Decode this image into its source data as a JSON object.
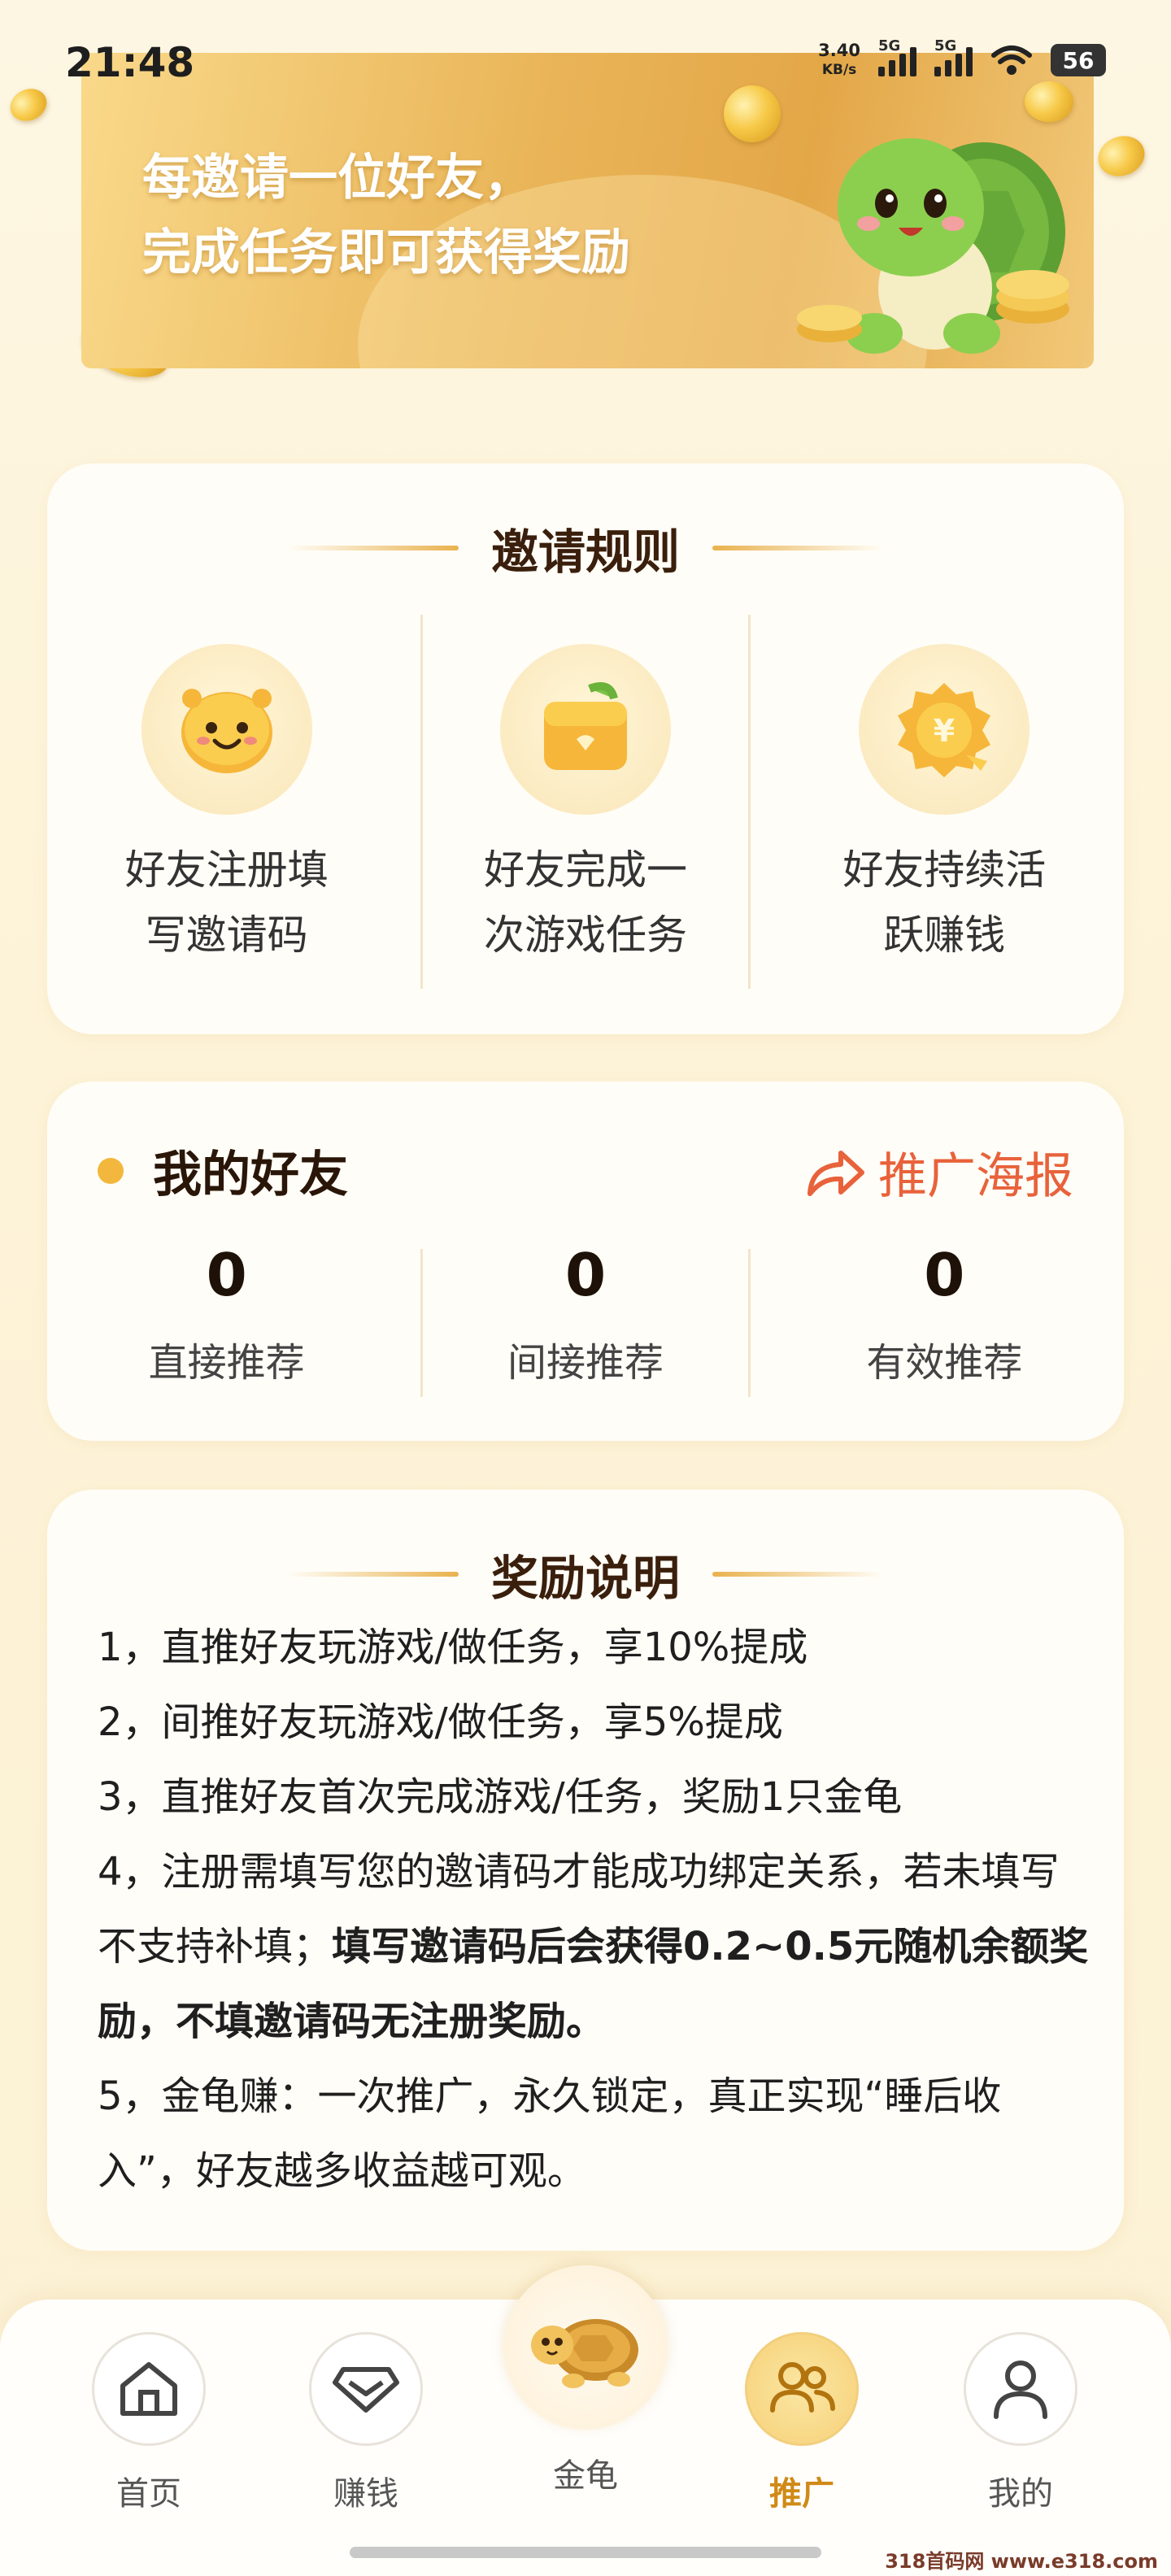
{
  "status": {
    "time": "21:48",
    "net_speed": "3.40",
    "net_unit": "KB/s",
    "sig1_label": "5G",
    "sig2_label": "5G",
    "battery": "56"
  },
  "banner": {
    "line1": "每邀请一位好友，",
    "line2": "完成任务即可获得奖励"
  },
  "rules": {
    "title": "邀请规则",
    "items": [
      {
        "line1": "好友注册填",
        "line2": "写邀请码",
        "icon": "smiley-face-icon"
      },
      {
        "line1": "好友完成一",
        "line2": "次游戏任务",
        "icon": "wallet-icon"
      },
      {
        "line1": "好友持续活",
        "line2": "跃赚钱",
        "icon": "yuan-badge-icon"
      }
    ]
  },
  "friends": {
    "title": "我的好友",
    "poster_label": "推广海报",
    "stats": [
      {
        "value": "0",
        "label": "直接推荐"
      },
      {
        "value": "0",
        "label": "间接推荐"
      },
      {
        "value": "0",
        "label": "有效推荐"
      }
    ]
  },
  "reward": {
    "title": "奖励说明",
    "item1": "1，直推好友玩游戏/做任务，享10%提成",
    "item2": "2，间推好友玩游戏/做任务，享5%提成",
    "item3": "3，直推好友首次完成游戏/任务，奖励1只金龟",
    "item4_normal": "4，注册需填写您的邀请码才能成功绑定关系，若未填写不支持补填；",
    "item4_bold": "填写邀请码后会获得0.2~0.5元随机余额奖励，不填邀请码无注册奖励。",
    "item5": "5，金龟赚：一次推广，永久锁定，真正实现“睡后收入”，好友越多收益越可观。"
  },
  "nav": {
    "items": [
      {
        "label": "首页",
        "icon": "home-icon"
      },
      {
        "label": "赚钱",
        "icon": "diamond-icon"
      },
      {
        "label": "金龟",
        "icon": "turtle-icon"
      },
      {
        "label": "推广",
        "icon": "people-icon"
      },
      {
        "label": "我的",
        "icon": "user-icon"
      }
    ],
    "active": "推广"
  },
  "watermark": "318首码网 www.e318.com",
  "colors": {
    "accent_orange": "#e8623b",
    "gold": "#f2b73c",
    "active_nav": "#d08a16"
  }
}
